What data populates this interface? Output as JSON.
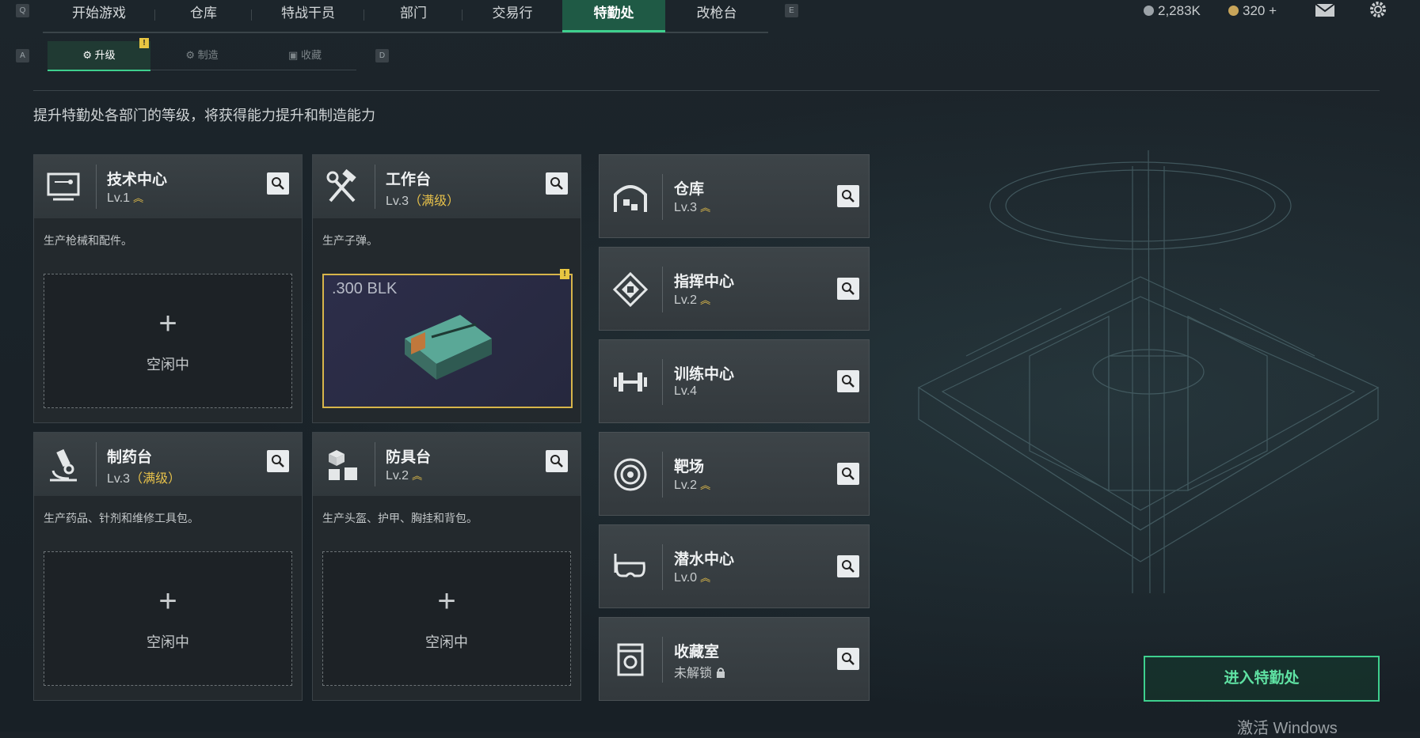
{
  "keys": {
    "left": "Q",
    "right": "E",
    "sub_left": "A",
    "sub_right": "D"
  },
  "nav": {
    "tabs": [
      {
        "label": "开始游戏"
      },
      {
        "label": "仓库"
      },
      {
        "label": "特战干员"
      },
      {
        "label": "部门"
      },
      {
        "label": "交易行"
      },
      {
        "label": "特勤处",
        "active": true
      },
      {
        "label": "改枪台"
      }
    ],
    "currency": [
      {
        "value": "2,283K"
      },
      {
        "value": "320 +"
      }
    ]
  },
  "subnav": {
    "tabs": [
      {
        "label": "升级",
        "active": true
      },
      {
        "label": "制造"
      },
      {
        "label": "收藏"
      }
    ],
    "alert": "!"
  },
  "subtitle": "提升特勤处各部门的等级，将获得能力提升和制造能力",
  "cards": [
    {
      "title": "技术中心",
      "level": "Lv.1",
      "maxed": "",
      "upgradable": true,
      "desc": "生产枪械和配件。",
      "slot_label": "空闲中",
      "icon": "computer-icon"
    },
    {
      "title": "工作台",
      "level": "Lv.3",
      "maxed": "（满级）",
      "upgradable": false,
      "desc": "生产子弹。",
      "slot_item": ".300 BLK",
      "icon": "tools-icon",
      "alert": "!"
    },
    {
      "title": "制药台",
      "level": "Lv.3",
      "maxed": "（满级）",
      "upgradable": false,
      "desc": "生产药品、针剂和维修工具包。",
      "slot_label": "空闲中",
      "icon": "microscope-icon"
    },
    {
      "title": "防具台",
      "level": "Lv.2",
      "maxed": "",
      "upgradable": true,
      "desc": "生产头盔、护甲、胸挂和背包。",
      "slot_label": "空闲中",
      "icon": "boxes-icon"
    }
  ],
  "facilities": [
    {
      "title": "仓库",
      "level": "Lv.3",
      "upgradable": true,
      "icon": "warehouse-icon"
    },
    {
      "title": "指挥中心",
      "level": "Lv.2",
      "upgradable": true,
      "icon": "chip-icon"
    },
    {
      "title": "训练中心",
      "level": "Lv.4",
      "upgradable": false,
      "icon": "dumbbell-icon"
    },
    {
      "title": "靶场",
      "level": "Lv.2",
      "upgradable": true,
      "icon": "target-icon"
    },
    {
      "title": "潜水中心",
      "level": "Lv.0",
      "upgradable": true,
      "icon": "diving-mask-icon"
    },
    {
      "title": "收藏室",
      "level": "未解锁",
      "upgradable": false,
      "locked": true,
      "icon": "vault-icon"
    }
  ],
  "enter_button": "进入特勤处",
  "watermark": "激活 Windows",
  "colors": {
    "accent": "#3ed08e",
    "gold": "#e6c04a",
    "alert": "#e8c642"
  }
}
